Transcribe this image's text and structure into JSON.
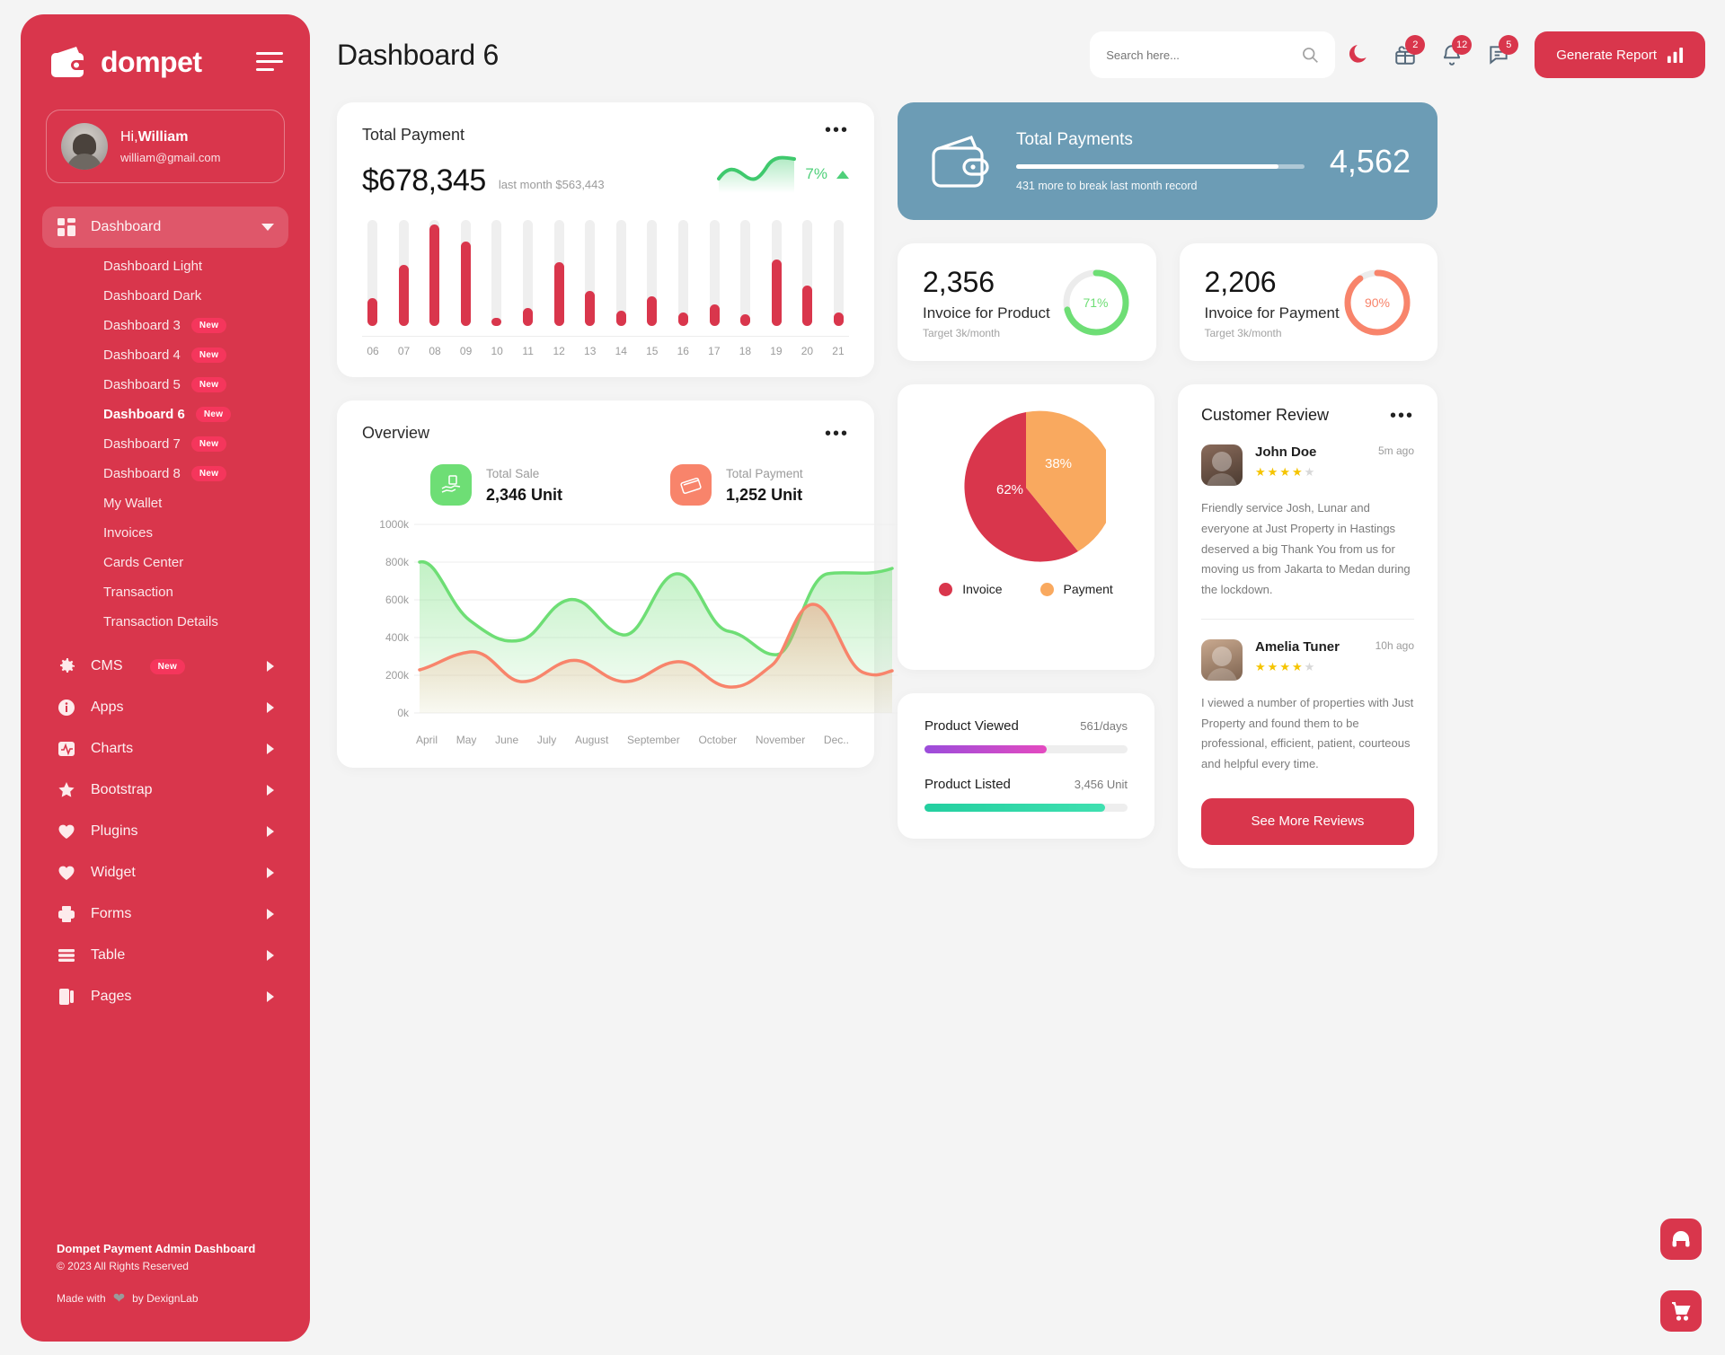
{
  "sidebar": {
    "brand": "dompet",
    "brand_logo_icon": "wallet-icon",
    "hamburger_icon": "menu-icon",
    "profile": {
      "greeting_prefix": "Hi,",
      "name": "William",
      "email": "william@gmail.com"
    },
    "dashboard_group": {
      "label": "Dashboard",
      "icon": "grid-icon",
      "items": [
        {
          "label": "Dashboard Light",
          "badge": ""
        },
        {
          "label": "Dashboard Dark",
          "badge": ""
        },
        {
          "label": "Dashboard 3",
          "badge": "New"
        },
        {
          "label": "Dashboard 4",
          "badge": "New"
        },
        {
          "label": "Dashboard 5",
          "badge": "New"
        },
        {
          "label": "Dashboard 6",
          "badge": "New"
        },
        {
          "label": "Dashboard 7",
          "badge": "New"
        },
        {
          "label": "Dashboard 8",
          "badge": "New"
        },
        {
          "label": "My Wallet",
          "badge": ""
        },
        {
          "label": "Invoices",
          "badge": ""
        },
        {
          "label": "Cards Center",
          "badge": ""
        },
        {
          "label": "Transaction",
          "badge": ""
        },
        {
          "label": "Transaction Details",
          "badge": ""
        }
      ]
    },
    "sections": [
      {
        "label": "CMS",
        "icon": "gear-icon",
        "badge": "New"
      },
      {
        "label": "Apps",
        "icon": "info-icon",
        "badge": ""
      },
      {
        "label": "Charts",
        "icon": "chart-activity-icon",
        "badge": ""
      },
      {
        "label": "Bootstrap",
        "icon": "star-icon",
        "badge": ""
      },
      {
        "label": "Plugins",
        "icon": "heart-icon",
        "badge": ""
      },
      {
        "label": "Widget",
        "icon": "heart-icon",
        "badge": ""
      },
      {
        "label": "Forms",
        "icon": "printer-icon",
        "badge": ""
      },
      {
        "label": "Table",
        "icon": "table-icon",
        "badge": ""
      },
      {
        "label": "Pages",
        "icon": "pages-icon",
        "badge": ""
      }
    ],
    "footer": {
      "line1": "Dompet Payment Admin Dashboard",
      "line2": "© 2023 All Rights Reserved",
      "made_prefix": "Made with",
      "made_suffix": "by DexignLab",
      "heart_icon": "heart-icon"
    }
  },
  "header": {
    "title": "Dashboard 6",
    "search_placeholder": "Search here...",
    "search_icon": "search-icon",
    "moon_icon": "moon-icon",
    "gift_icon": "gift-icon",
    "gift_count": "2",
    "bell_icon": "bell-icon",
    "bell_count": "12",
    "message_icon": "message-icon",
    "message_count": "5",
    "generate_label": "Generate Report",
    "generate_icon": "bar-chart-icon"
  },
  "total_payment": {
    "title": "Total Payment",
    "amount": "$678,345",
    "last_month": "last month $563,443",
    "percent": "7%",
    "trend_icon": "triangle-up-icon",
    "menu_icon": "more-dots-icon"
  },
  "total_payments_banner": {
    "title": "Total Payments",
    "value": "4,562",
    "subtitle": "431 more to break last month record",
    "icon": "wallet-icon",
    "progress_percent": 91,
    "color": "#6c9cb5"
  },
  "invoice_cards": [
    {
      "value": "2,356",
      "label": "Invoice for Product",
      "target": "Target 3k/month",
      "percent": "71%",
      "percent_value": 71,
      "color": "#6ede75"
    },
    {
      "value": "2,206",
      "label": "Invoice for Payment",
      "target": "Target 3k/month",
      "percent": "90%",
      "percent_value": 90,
      "color": "#f8846b"
    }
  ],
  "overview": {
    "title": "Overview",
    "menu_icon": "more-dots-icon",
    "stats": [
      {
        "label": "Total Sale",
        "value": "2,346 Unit",
        "icon": "hand-money-icon",
        "color": "#6ede75"
      },
      {
        "label": "Total Payment",
        "value": "1,252 Unit",
        "icon": "card-swipe-icon",
        "color": "#f8846b"
      }
    ]
  },
  "pie": {
    "legend": [
      {
        "label": "Invoice",
        "color": "#d9364c"
      },
      {
        "label": "Payment",
        "color": "#f9a95f"
      }
    ]
  },
  "product_stats": [
    {
      "label": "Product Viewed",
      "value": "561/days",
      "percent": 60,
      "color_from": "#9b4ddb",
      "color_to": "#e44ac0"
    },
    {
      "label": "Product Listed",
      "value": "3,456 Unit",
      "percent": 89,
      "color_from": "#23cfa0",
      "color_to": "#3fe0b0"
    }
  ],
  "reviews": {
    "title": "Customer Review",
    "menu_icon": "more-dots-icon",
    "items": [
      {
        "name": "John Doe",
        "time": "5m ago",
        "stars": 4,
        "text": "Friendly service Josh, Lunar and everyone at Just Property in Hastings deserved a big Thank You from us for moving us from Jakarta to Medan during the lockdown."
      },
      {
        "name": "Amelia Tuner",
        "time": "10h ago",
        "stars": 4,
        "text": "I viewed a number of properties with Just Property and found them to be professional, efficient, patient, courteous and helpful every time."
      }
    ],
    "button_label": "See More Reviews"
  },
  "fabs": [
    {
      "icon": "headphones-icon"
    },
    {
      "icon": "cart-icon"
    }
  ],
  "chart_data": [
    {
      "type": "bar",
      "title": "Total Payment",
      "categories": [
        "06",
        "07",
        "08",
        "09",
        "10",
        "11",
        "12",
        "13",
        "14",
        "15",
        "16",
        "17",
        "18",
        "19",
        "20",
        "21"
      ],
      "values": [
        26,
        58,
        96,
        80,
        8,
        17,
        60,
        33,
        14,
        28,
        13,
        20,
        11,
        63,
        38,
        13
      ],
      "ylim": [
        0,
        100
      ],
      "series_color": "#d9364c",
      "track_color": "#efefef",
      "xlabel": "",
      "ylabel": "",
      "grid": false
    },
    {
      "type": "area",
      "title": "Overview",
      "x": [
        "April",
        "May",
        "June",
        "July",
        "August",
        "September",
        "October",
        "November",
        "Dec.."
      ],
      "ylim": [
        0,
        1000000
      ],
      "ytick_labels": [
        "0k",
        "200k",
        "400k",
        "600k",
        "800k",
        "1000k"
      ],
      "ytick_values": [
        0,
        200000,
        400000,
        600000,
        800000,
        1000000
      ],
      "grid": true,
      "series": [
        {
          "name": "Total Sale",
          "color": "#6ede75",
          "values": [
            800000,
            480000,
            390000,
            520000,
            430000,
            640000,
            460000,
            360000,
            640000
          ]
        },
        {
          "name": "Total Payment",
          "color": "#f8846b",
          "values": [
            230000,
            320000,
            190000,
            300000,
            200000,
            290000,
            160000,
            600000,
            230000
          ]
        }
      ],
      "legend": "none"
    },
    {
      "type": "pie",
      "labels": [
        "Invoice",
        "Payment"
      ],
      "values": [
        62,
        38
      ],
      "value_labels": [
        "62%",
        "38%"
      ],
      "colors": [
        "#d9364c",
        "#f9a95f"
      ]
    },
    {
      "type": "gauge",
      "title": "Invoice for Product",
      "value": 71,
      "max": 100,
      "label": "71%",
      "color": "#6ede75"
    },
    {
      "type": "gauge",
      "title": "Invoice for Payment",
      "value": 90,
      "max": 100,
      "label": "90%",
      "color": "#f8846b"
    }
  ]
}
